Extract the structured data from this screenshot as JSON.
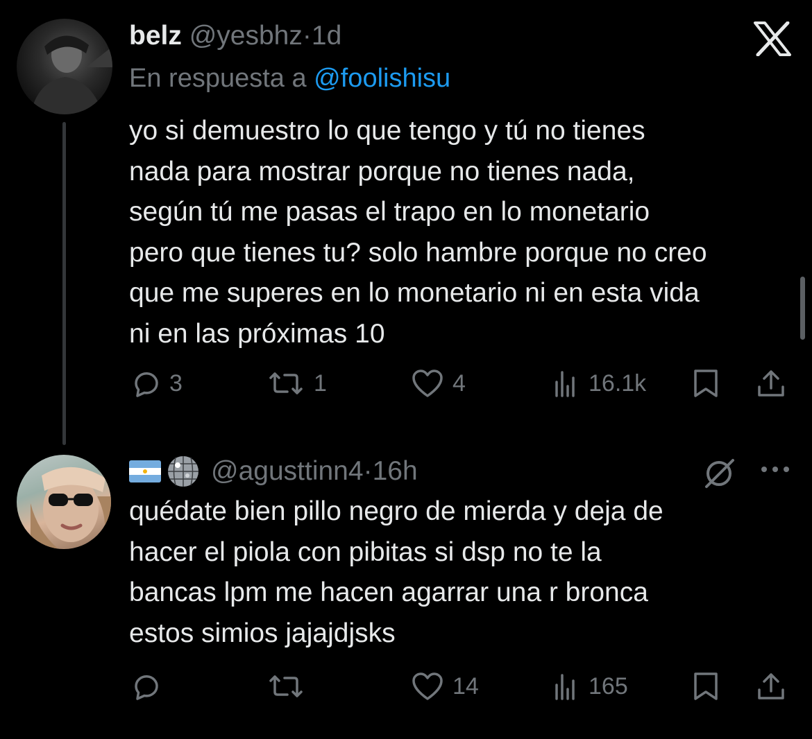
{
  "close_icon": "x-logo-icon",
  "tweet1": {
    "name": "belz",
    "handle": "@yesbhz",
    "separator": "·",
    "time": "1d",
    "reply_prefix": "En respuesta a",
    "reply_to": "@foolishisu",
    "lines": [
      "yo si demuestro lo que tengo y tú no tienes",
      "nada para mostrar porque no tienes nada,",
      "según tú me pasas el trapo en lo monetario",
      "pero que tienes tu? solo hambre porque no creo",
      "que me superes en lo monetario ni en esta vida",
      "ni en las próximas 10"
    ],
    "actions": {
      "replies": "3",
      "reposts": "1",
      "likes": "4",
      "views": "16.1k"
    }
  },
  "tweet2": {
    "handle": "@agusttinn4",
    "separator": "·",
    "time": "16h",
    "emojis": [
      "argentina-flag",
      "mirror-ball"
    ],
    "lines": [
      "quédate bien pillo negro de mierda y deja de",
      "hacer el piola con pibitas si dsp no te la",
      "bancas lpm me hacen agarrar una r bronca",
      "estos simios jajajdjsks"
    ],
    "actions": {
      "replies": "",
      "reposts": "",
      "likes": "14",
      "views": "165"
    }
  },
  "colors": {
    "background": "#000000",
    "text": "#e7e9ea",
    "muted": "#71767b",
    "link": "#1d9bf0",
    "thread_line": "#333639"
  }
}
